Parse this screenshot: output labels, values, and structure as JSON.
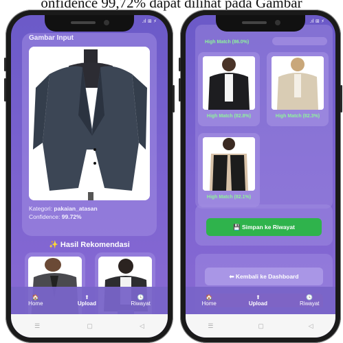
{
  "caption": "onfidence 99,72% dapat dilihat pada Gambar",
  "left_phone": {
    "status_icons": ".ıl ⊞ ⚡",
    "input_card": {
      "heading": "Gambar Input",
      "category_label": "Kategori:",
      "category_value": "pakaian_atasan",
      "confidence_label": "Confidence:",
      "confidence_value": "99.72%"
    },
    "recommendation_title": "✨ Hasil Rekomendasi",
    "nav": [
      {
        "icon": "home-icon",
        "label": "Home"
      },
      {
        "icon": "upload-icon",
        "label": "Upload"
      },
      {
        "icon": "history-icon",
        "label": "Riwayat"
      }
    ]
  },
  "right_phone": {
    "status_icons": ".ıl ⊞ ⚡",
    "top_match_label": "High Match (86.0%)",
    "recommendations": [
      {
        "label": "High Match (82.8%)"
      },
      {
        "label": "High Match (82.3%)"
      },
      {
        "label": "High Match (82.1%)"
      }
    ],
    "save_button": "💾 Simpan ke Riwayat",
    "back_button": "⬅ Kembali ke Dashboard",
    "nav": [
      {
        "icon": "home-icon",
        "label": "Home"
      },
      {
        "icon": "upload-icon",
        "label": "Upload"
      },
      {
        "icon": "history-icon",
        "label": "Riwayat"
      }
    ]
  },
  "colors": {
    "screen_bg": "#7a62cf",
    "match_text": "#8ef59b",
    "save_button": "#2fb34c",
    "back_button": "#a996e6"
  }
}
